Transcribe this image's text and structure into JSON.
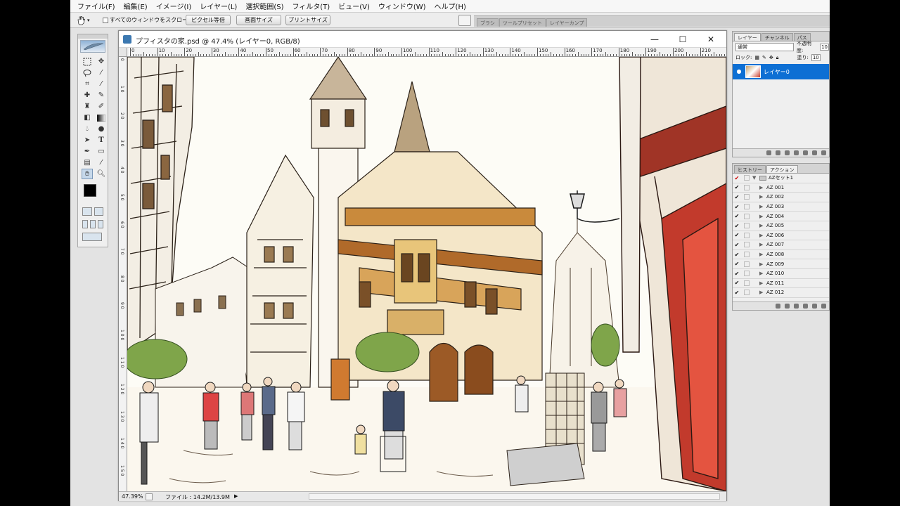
{
  "menu": [
    "ファイル(F)",
    "編集(E)",
    "イメージ(I)",
    "レイヤー(L)",
    "選択範囲(S)",
    "フィルタ(T)",
    "ビュー(V)",
    "ウィンドウ(W)",
    "ヘルプ(H)"
  ],
  "options": {
    "scroll_all_label": "すべてのウィンドウをスクロール",
    "actual_pixels": "ピクセル等倍",
    "fit_screen": "画面サイズ",
    "print_size": "プリントサイズ"
  },
  "dock_tabs": [
    "ブラシ",
    "ツールプリセット",
    "レイヤーカンプ"
  ],
  "document": {
    "title": "プフィスタの家.psd @ 47.4% (レイヤー0, RGB/8)",
    "zoom": "47.39%",
    "file_info": "ファイル : 14.2M/13.9M"
  },
  "ruler_top": [
    "0",
    "10",
    "20",
    "30",
    "40",
    "50",
    "60",
    "70",
    "80",
    "90",
    "100",
    "110",
    "120",
    "130",
    "140",
    "150",
    "160",
    "170",
    "180",
    "190",
    "200",
    "210"
  ],
  "ruler_left": [
    "0",
    "1 0",
    "2 0",
    "3 0",
    "4 0",
    "5 0",
    "6 0",
    "7 0",
    "8 0",
    "9 0",
    "1 0 0",
    "1 1 0",
    "1 2 0",
    "1 3 0",
    "1 4 0",
    "1 5 0"
  ],
  "layers_panel": {
    "tabs": [
      "レイヤー",
      "チャンネル",
      "パス"
    ],
    "blend_mode": "通常",
    "opacity_label": "不透明度:",
    "opacity_value": "10",
    "lock_label": "ロック:",
    "fill_label": "塗り:",
    "fill_value": "10",
    "layer_name": "レイヤー0"
  },
  "actions_panel": {
    "tabs": [
      "ヒストリー",
      "アクション"
    ],
    "set_name": "AZセット1",
    "items": [
      "AZ 001",
      "AZ 002",
      "AZ 003",
      "AZ 004",
      "AZ 005",
      "AZ 006",
      "AZ 007",
      "AZ 008",
      "AZ 009",
      "AZ 010",
      "AZ 011",
      "AZ 012"
    ]
  }
}
